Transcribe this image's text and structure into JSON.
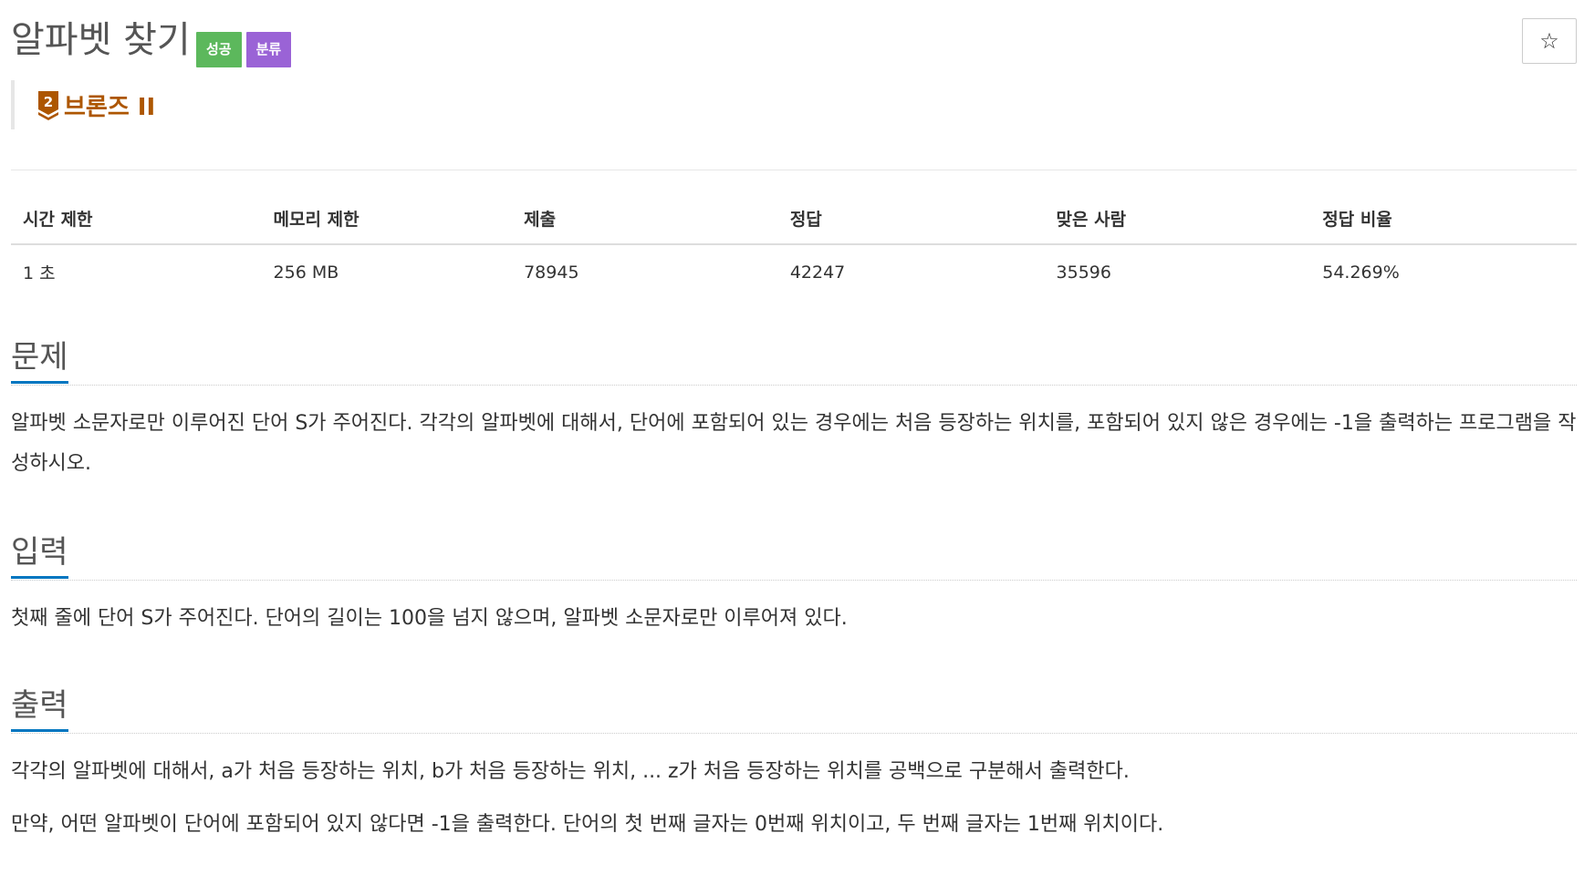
{
  "problem": {
    "title": "알파벳 찾기",
    "badges": [
      {
        "label": "성공",
        "color": "#5cb85c"
      },
      {
        "label": "분류",
        "color": "#9a63d6"
      }
    ],
    "tier": {
      "icon": "bronze-2-tier-icon",
      "number": "2",
      "label": "브론즈 II",
      "color": "#ad5600"
    },
    "star_icon": "star-outline-icon"
  },
  "info_table": {
    "headers": [
      "시간 제한",
      "메모리 제한",
      "제출",
      "정답",
      "맞은 사람",
      "정답 비율"
    ],
    "row": [
      "1 초",
      "256 MB",
      "78945",
      "42247",
      "35596",
      "54.269%"
    ]
  },
  "sections": {
    "description": {
      "title": "문제",
      "paragraphs": [
        "알파벳 소문자로만 이루어진 단어 S가 주어진다. 각각의 알파벳에 대해서, 단어에 포함되어 있는 경우에는 처음 등장하는 위치를, 포함되어 있지 않은 경우에는 -1을 출력하는 프로그램을 작성하시오."
      ]
    },
    "input": {
      "title": "입력",
      "paragraphs": [
        "첫째 줄에 단어 S가 주어진다. 단어의 길이는 100을 넘지 않으며, 알파벳 소문자로만 이루어져 있다."
      ]
    },
    "output": {
      "title": "출력",
      "paragraphs": [
        "각각의 알파벳에 대해서, a가 처음 등장하는 위치, b가 처음 등장하는 위치, ... z가 처음 등장하는 위치를 공백으로 구분해서 출력한다.",
        "만약, 어떤 알파벳이 단어에 포함되어 있지 않다면 -1을 출력한다. 단어의 첫 번째 글자는 0번째 위치이고, 두 번째 글자는 1번째 위치이다."
      ]
    }
  }
}
